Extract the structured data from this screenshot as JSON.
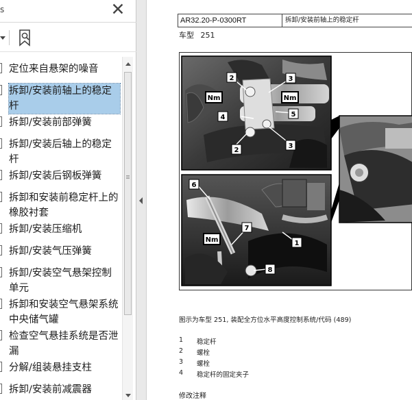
{
  "panel": {
    "title_fragment": "s",
    "close_glyph": "✕",
    "bookmarks": [
      {
        "label": "定位来自悬架的噪音",
        "selected": false
      },
      {
        "label": "拆卸/安装前轴上的稳定杆",
        "selected": true
      },
      {
        "label": "拆卸/安装前部弹簧",
        "selected": false
      },
      {
        "label": "拆卸/安装后轴上的稳定杆",
        "selected": false
      },
      {
        "label": "拆卸/安装后钢板弹簧",
        "selected": false
      },
      {
        "label": "拆卸和安装前稳定杆上的橡胶衬套",
        "selected": false
      },
      {
        "label": "拆卸/安装压缩机",
        "selected": false
      },
      {
        "label": "拆卸/安装气压弹簧",
        "selected": false
      },
      {
        "label": "拆卸/安装空气悬架控制单元",
        "selected": false
      },
      {
        "label": "拆卸和安装空气悬架系统中央储气罐",
        "selected": false
      },
      {
        "label": "检查空气悬挂系统是否泄漏",
        "selected": false
      },
      {
        "label": "分解/组装悬挂支柱",
        "selected": false
      },
      {
        "label": "拆卸/安装前减震器",
        "selected": false
      }
    ]
  },
  "document": {
    "doc_code": "AR32.20-P-0300RT",
    "doc_title": "拆卸/安装前轴上的稳定杆",
    "model_label": "车型",
    "model_value": "251",
    "figure": {
      "torque_label": "Nm",
      "callouts": [
        "2",
        "3",
        "4",
        "5",
        "2",
        "3",
        "6",
        "7",
        "1",
        "8"
      ]
    },
    "caption": "图示为车型 251, 装配全方位水平高度控制系统/代码 (489)",
    "legend": [
      {
        "num": "1",
        "text": "稳定杆"
      },
      {
        "num": "2",
        "text": "螺栓"
      },
      {
        "num": "3",
        "text": "螺栓"
      },
      {
        "num": "4",
        "text": "稳定杆的固定夹子"
      }
    ],
    "notes_heading": "修改注释"
  }
}
